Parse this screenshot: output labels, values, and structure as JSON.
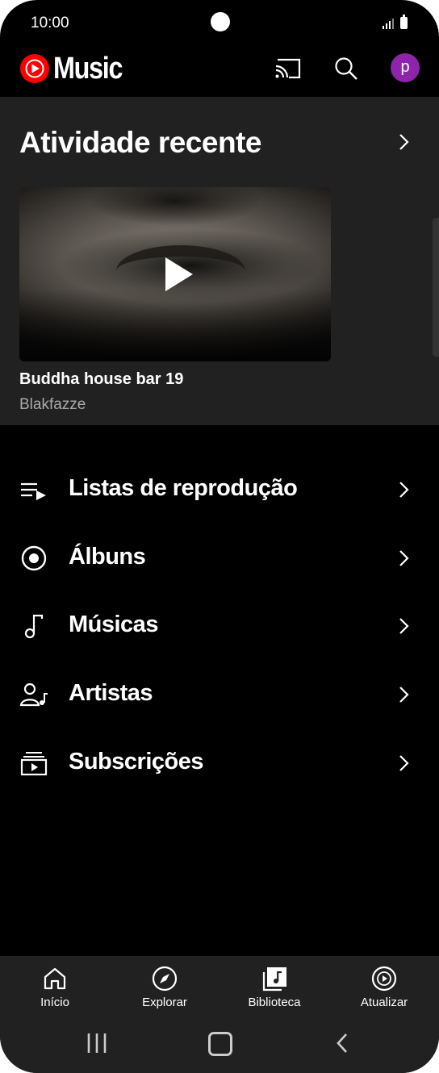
{
  "status_bar": {
    "time": "10:00"
  },
  "app": {
    "title": "Music",
    "avatar_letter": "p",
    "brand_color": "#ff0000",
    "avatar_color": "#8e24aa"
  },
  "recent": {
    "title": "Atividade recente",
    "item": {
      "title": "Buddha house bar 19",
      "artist": "Blakfazze"
    }
  },
  "library": {
    "items": [
      {
        "label": "Listas de reprodução",
        "icon": "playlist-icon"
      },
      {
        "label": "Álbuns",
        "icon": "album-icon"
      },
      {
        "label": "Músicas",
        "icon": "music-note-icon"
      },
      {
        "label": "Artistas",
        "icon": "artist-icon"
      },
      {
        "label": "Subscrições",
        "icon": "subscriptions-icon"
      }
    ]
  },
  "bottom_nav": {
    "items": [
      {
        "label": "Início",
        "icon": "home-icon"
      },
      {
        "label": "Explorar",
        "icon": "explore-icon"
      },
      {
        "label": "Biblioteca",
        "icon": "library-icon",
        "selected": true
      },
      {
        "label": "Atualizar",
        "icon": "upgrade-icon"
      }
    ]
  }
}
